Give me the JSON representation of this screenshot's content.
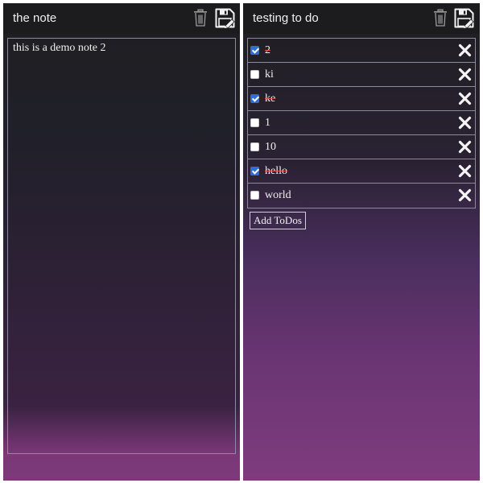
{
  "note_panel": {
    "title": "the note",
    "trash_icon": "trash-icon",
    "save_icon": "floppy-save-icon",
    "content": "this is a demo note 2"
  },
  "todo_panel": {
    "title": "testing to do",
    "trash_icon": "trash-icon",
    "save_icon": "floppy-save-icon",
    "items": [
      {
        "label": "2",
        "checked": true
      },
      {
        "label": "ki",
        "checked": false
      },
      {
        "label": "ke",
        "checked": true
      },
      {
        "label": "1",
        "checked": false
      },
      {
        "label": "10",
        "checked": false
      },
      {
        "label": "hello",
        "checked": true
      },
      {
        "label": "world",
        "checked": false
      }
    ],
    "delete_icon": "x-close-icon",
    "add_button_label": "Add ToDos"
  },
  "colors": {
    "header_bg": "#1c1c1e",
    "checkbox_checked": "#2f6fd3",
    "strike_color": "#e05050",
    "gradient_bottom": "#7c3a7c"
  }
}
